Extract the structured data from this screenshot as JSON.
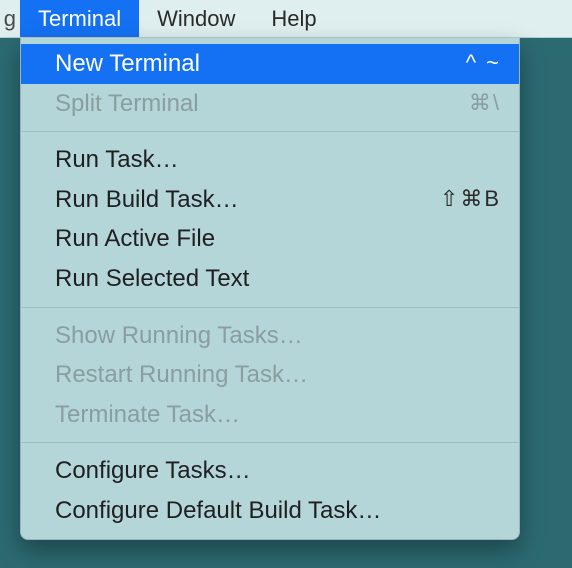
{
  "menubar": {
    "left_fragment": "g",
    "items": [
      {
        "label": "Terminal",
        "active": true
      },
      {
        "label": "Window",
        "active": false
      },
      {
        "label": "Help",
        "active": false
      }
    ]
  },
  "dropdown": {
    "groups": [
      [
        {
          "label": "New Terminal",
          "shortcut": "^ ~",
          "state": "highlight"
        },
        {
          "label": "Split Terminal",
          "shortcut": "⌘\\",
          "state": "disabled"
        }
      ],
      [
        {
          "label": "Run Task…",
          "shortcut": "",
          "state": "normal"
        },
        {
          "label": "Run Build Task…",
          "shortcut": "⇧⌘B",
          "state": "normal"
        },
        {
          "label": "Run Active File",
          "shortcut": "",
          "state": "normal"
        },
        {
          "label": "Run Selected Text",
          "shortcut": "",
          "state": "normal"
        }
      ],
      [
        {
          "label": "Show Running Tasks…",
          "shortcut": "",
          "state": "disabled"
        },
        {
          "label": "Restart Running Task…",
          "shortcut": "",
          "state": "disabled"
        },
        {
          "label": "Terminate Task…",
          "shortcut": "",
          "state": "disabled"
        }
      ],
      [
        {
          "label": "Configure Tasks…",
          "shortcut": "",
          "state": "normal"
        },
        {
          "label": "Configure Default Build Task…",
          "shortcut": "",
          "state": "normal"
        }
      ]
    ]
  }
}
